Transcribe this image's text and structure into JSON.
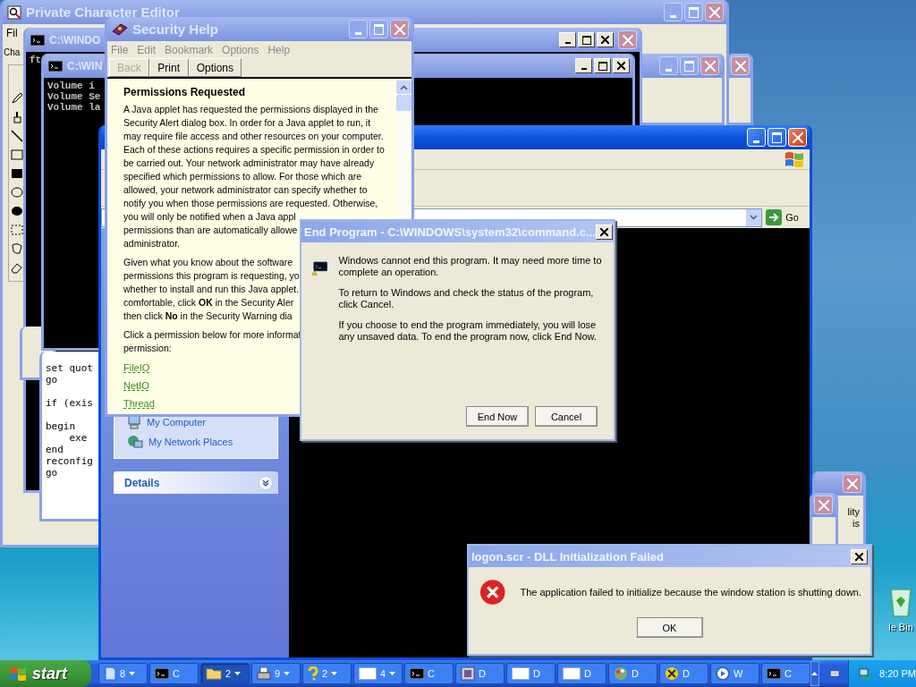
{
  "char_editor": {
    "title": "Private Character Editor",
    "menu": [
      "Fil"
    ],
    "label": "Cha"
  },
  "cmd_back": {
    "title": "C:\\WINDO",
    "lines": [
      "ft"
    ]
  },
  "cmd_front": {
    "title": "C:\\WIN",
    "lines": [
      "Volume i",
      "Volume Se",
      "Volume la"
    ]
  },
  "code_window": {
    "blocks": [
      [
        "set quot",
        "go"
      ],
      [
        "if (exis"
      ],
      [
        "begin",
        "    exe",
        "end",
        "reconfig",
        "go"
      ]
    ]
  },
  "explorer": {
    "go_label": "Go",
    "sidebar": [
      {
        "label": "My Computer",
        "kind": "computer"
      },
      {
        "label": "My Network Places",
        "kind": "network"
      }
    ],
    "details_title": "Details"
  },
  "security_help": {
    "title": "Security Help",
    "menu": [
      "File",
      "Edit",
      "Bookmark",
      "Options",
      "Help"
    ],
    "toolbar": [
      {
        "label": "Back",
        "disabled": true
      },
      {
        "label": "Print",
        "disabled": false
      },
      {
        "label": "Options",
        "disabled": false
      }
    ],
    "heading": "Permissions Requested",
    "paragraphs": [
      [
        "A Java applet has requested the permissions displayed in the",
        "Security Alert dialog box. In order for a Java applet to run, it",
        "may require file access and other resources on your computer.",
        "Each of these actions requires a specific permission in order to",
        "be carried out. Your network administrator may have already",
        "specified which permissions to allow. For those which are",
        "allowed, your network administrator can specify whether to",
        "notify you when those permissions are requested. Otherwise,",
        "you will only be notified when a Java appl",
        "permissions than are automatically allowe",
        "administrator."
      ],
      [
        "Given what you know about the software",
        "permissions this program is requesting, yo",
        "whether to install and run this Java applet.",
        "comfortable, click **OK** in the Security Aler",
        "then click **No** in the Security Warning dia"
      ],
      [
        "Click a permission below for more informat",
        "permission:"
      ]
    ],
    "links": [
      "FileIO",
      "NetIO",
      "Thread"
    ]
  },
  "end_program": {
    "title": "End Program - C:\\WINDOWS\\system32\\command.c...",
    "paragraphs": [
      "Windows cannot end this program. It may need more time to complete an operation.",
      "To return to Windows and check the status of the program, click Cancel.",
      "If you choose to end the program immediately, you will lose any unsaved data. To end the program now, click End Now."
    ],
    "buttons": [
      "End Now",
      "Cancel"
    ]
  },
  "side_window": {
    "lines": [
      "lity",
      "is"
    ]
  },
  "logon_error": {
    "title": "logon.scr - DLL Initialization Failed",
    "message": "The application failed to initialize because the window station is shutting down.",
    "button": "OK"
  },
  "desktop_icons": [
    {
      "label": "le Bin"
    }
  ],
  "taskbar": {
    "start": "start",
    "buttons": [
      {
        "kind": "book",
        "label": "8",
        "grouped": true,
        "selected": false
      },
      {
        "kind": "cmd",
        "label": "C",
        "grouped": false,
        "selected": false
      },
      {
        "kind": "folder",
        "label": "2",
        "grouped": true,
        "selected": true
      },
      {
        "kind": "printer",
        "label": "9",
        "grouped": true,
        "selected": false
      },
      {
        "kind": "help",
        "label": "2",
        "grouped": true,
        "selected": false
      },
      {
        "kind": "window",
        "label": "4",
        "grouped": true,
        "selected": false
      },
      {
        "kind": "cmd",
        "label": "C",
        "grouped": false,
        "selected": false
      },
      {
        "kind": "app",
        "label": "D",
        "grouped": false,
        "selected": false
      },
      {
        "kind": "window",
        "label": "D",
        "grouped": false,
        "selected": false
      },
      {
        "kind": "window",
        "label": "D",
        "grouped": false,
        "selected": false
      },
      {
        "kind": "paint",
        "label": "D",
        "grouped": false,
        "selected": false
      },
      {
        "kind": "tools",
        "label": "D",
        "grouped": false,
        "selected": false
      },
      {
        "kind": "media",
        "label": "W",
        "grouped": false,
        "selected": false
      },
      {
        "kind": "cmd",
        "label": "C",
        "grouped": false,
        "selected": false
      }
    ],
    "clock": "8:20 PM"
  }
}
